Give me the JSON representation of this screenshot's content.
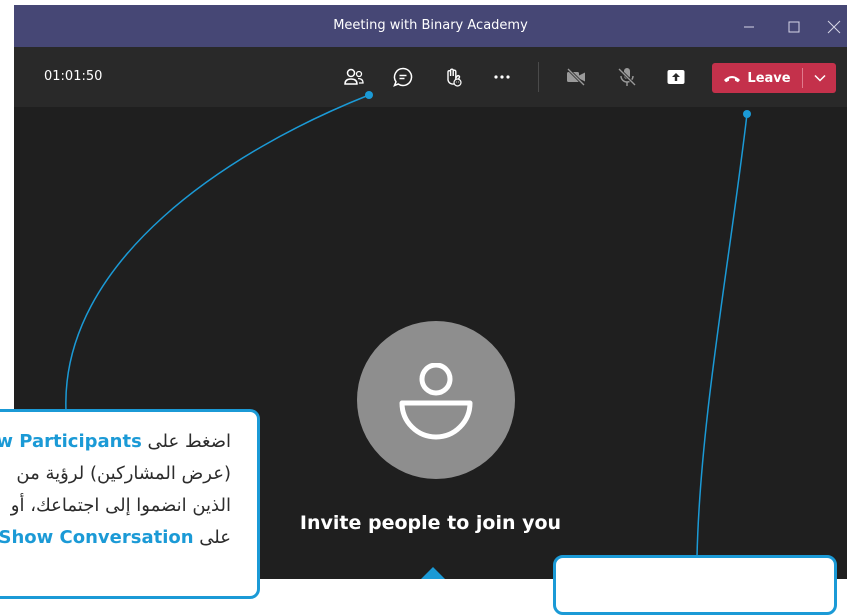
{
  "window": {
    "title": "Meeting with Binary Academy"
  },
  "toolbar": {
    "timer": "01:01:50",
    "leave_label": "Leave"
  },
  "stage": {
    "invite_text": "Invite people to join you"
  },
  "callout_left": {
    "line1_prefix": "اضغط على ",
    "line1_bold": "Show Participants",
    "line2": "(عرض المشاركين) لرؤية من",
    "line3": "الذين انضموا إلى اجتماعك، أو",
    "line4_prefix": "على ",
    "line4_bold": "Show Conversation"
  },
  "colors": {
    "titlebar": "#464775",
    "leave": "#c4314b",
    "callout": "#1b9ad6"
  }
}
